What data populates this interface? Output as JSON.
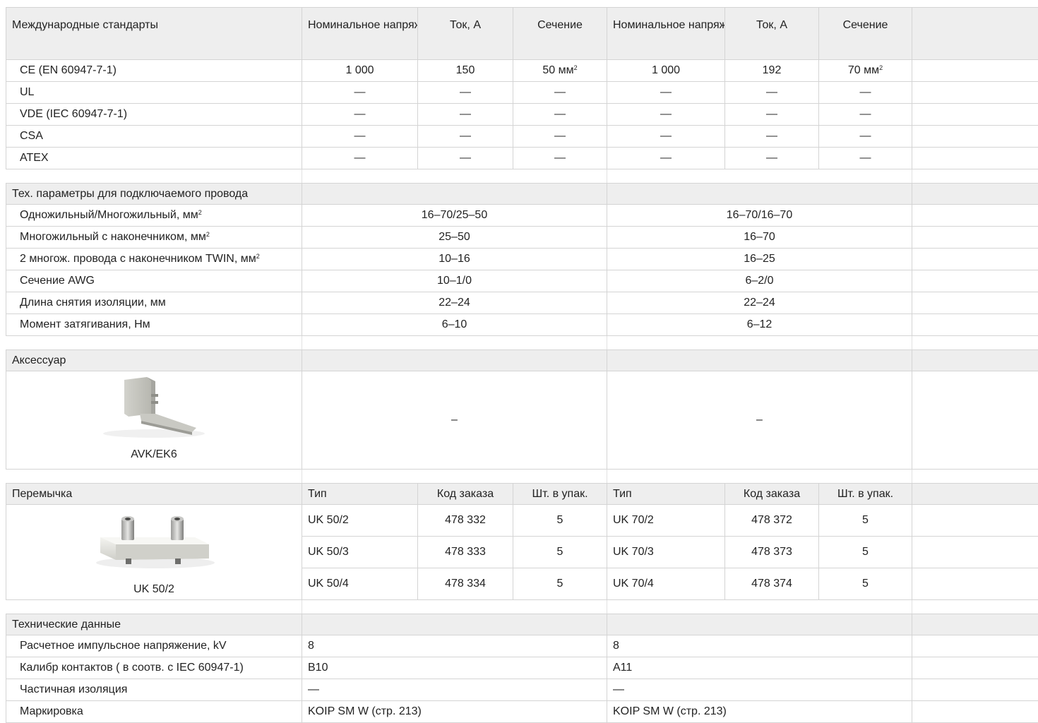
{
  "header": {
    "standards": "Международные стандарты",
    "voltage": "Номинальное напряжение, V ~",
    "current": "Ток, А",
    "section": "Сечение"
  },
  "standards": [
    {
      "name": "CE (EN 60947-7-1)",
      "a": [
        "1 000",
        "150",
        "50 мм"
      ],
      "b": [
        "1 000",
        "192",
        "70 мм"
      ],
      "sup": "2"
    },
    {
      "name": "UL",
      "a": [
        "—",
        "—",
        "—"
      ],
      "b": [
        "—",
        "—",
        "—"
      ]
    },
    {
      "name": "VDE (IEC 60947-7-1)",
      "a": [
        "—",
        "—",
        "—"
      ],
      "b": [
        "—",
        "—",
        "—"
      ]
    },
    {
      "name": "CSA",
      "a": [
        "—",
        "—",
        "—"
      ],
      "b": [
        "—",
        "—",
        "—"
      ]
    },
    {
      "name": "ATEX",
      "a": [
        "—",
        "—",
        "—"
      ],
      "b": [
        "—",
        "—",
        "—"
      ]
    }
  ],
  "wire": {
    "title": "Тех. параметры для подключаемого провода",
    "sup": "2",
    "rows": [
      {
        "label": "Одножильный/Многожильный, мм",
        "sup": true,
        "a": "16–70/25–50",
        "b": "16–70/16–70"
      },
      {
        "label": "Многожильный с наконечником, мм",
        "sup": true,
        "a": "25–50",
        "b": "16–70"
      },
      {
        "label": "2 многож. провода с наконечником TWIN, мм",
        "sup": true,
        "a": "10–16",
        "b": "16–25"
      },
      {
        "label": "Сечение AWG",
        "sup": false,
        "a": "10–1/0",
        "b": "6–2/0"
      },
      {
        "label": "Длина снятия изоляции, мм",
        "sup": false,
        "a": "22–24",
        "b": "22–24"
      },
      {
        "label": "Момент затягивания, Нм",
        "sup": false,
        "a": "6–10",
        "b": "6–12"
      }
    ]
  },
  "accessory": {
    "title": "Аксессуар",
    "caption": "AVK/EK6",
    "a": "–",
    "b": "–"
  },
  "jumper": {
    "title": "Перемычка",
    "caption": "UK 50/2",
    "cols": {
      "type": "Тип",
      "code": "Код заказа",
      "qty": "Шт. в упак."
    },
    "rows": [
      {
        "a": [
          "UK 50/2",
          "478 332",
          "5"
        ],
        "b": [
          "UK 70/2",
          "478 372",
          "5"
        ]
      },
      {
        "a": [
          "UK 50/3",
          "478 333",
          "5"
        ],
        "b": [
          "UK 70/3",
          "478 373",
          "5"
        ]
      },
      {
        "a": [
          "UK 50/4",
          "478 334",
          "5"
        ],
        "b": [
          "UK 70/4",
          "478 374",
          "5"
        ]
      }
    ]
  },
  "tech": {
    "title": "Технические данные",
    "rows": [
      {
        "label": "Расчетное импульсное напряжение, kV",
        "a": "8",
        "b": "8"
      },
      {
        "label": "Калибр контактов ( в соотв. с IEC 60947-1)",
        "a": "B10",
        "b": "A11"
      },
      {
        "label": "Частичная изоляция",
        "a": "—",
        "b": "—"
      },
      {
        "label": "Маркировка",
        "a": "KOIP SM W (стр. 213)",
        "b": "KOIP SM W (стр. 213)"
      }
    ]
  }
}
